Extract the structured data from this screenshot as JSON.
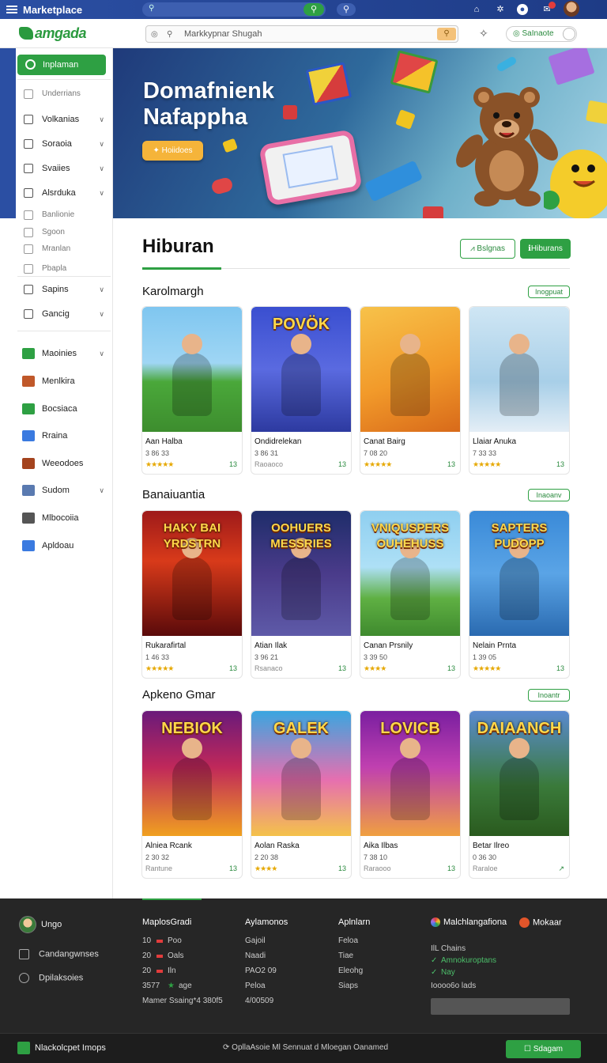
{
  "topbar": {
    "title": "Marketplace"
  },
  "header": {
    "logo": "amgada",
    "search_placeholder": "Markkypnar Shugah",
    "toggle_label": "SaInaote"
  },
  "sidebar": {
    "active": "Inplaman",
    "items": [
      {
        "label": "Underrians",
        "small": true,
        "chev": false
      },
      {
        "label": "Volkanias",
        "chev": true
      },
      {
        "label": "Soraoia",
        "chev": true
      },
      {
        "label": "Svaiies",
        "chev": true
      },
      {
        "label": "Alsrduka",
        "chev": true
      },
      {
        "label": "Banlionie",
        "small": true
      },
      {
        "label": "Sgoon",
        "small": true
      },
      {
        "label": "Mranlan",
        "small": true
      },
      {
        "label": "Pbapla",
        "small": true
      },
      {
        "label": "Sapins",
        "chev": true
      },
      {
        "label": "Gancig",
        "chev": true
      },
      {
        "label": "Maoinies",
        "chev": true
      },
      {
        "label": "Menlkira"
      },
      {
        "label": "Bocsiaca"
      },
      {
        "label": "Rraina"
      },
      {
        "label": "Weeodoes"
      },
      {
        "label": "Sudom",
        "chev": true
      },
      {
        "label": "Mlbocoiia"
      },
      {
        "label": "Apldoau"
      }
    ]
  },
  "hero": {
    "title_line1": "Domafnienk",
    "title_line2": "Nafappha",
    "button": "Hoiidoes"
  },
  "main": {
    "title": "Hiburan",
    "btn_outline": "Bslgnas",
    "btn_solid": "Hiburans"
  },
  "sections": [
    {
      "title": "Karolmargh",
      "pill": "Inogpuat",
      "cards": [
        {
          "name": "Aan Halba",
          "meta": "3 86 33",
          "rating": "★★★★★",
          "dl": "13",
          "art_title": ""
        },
        {
          "name": "Ondidrelekan",
          "meta": "3 86 31",
          "rating": "Raoaoco",
          "dl": "13",
          "art_title": "POVÖK"
        },
        {
          "name": "Canat Bairg",
          "meta": "7 08 20",
          "rating": "★★★★★",
          "dl": "13",
          "art_title": ""
        },
        {
          "name": "Llaiar Anuka",
          "meta": "7 33 33",
          "rating": "★★★★★",
          "dl": "13",
          "art_title": ""
        }
      ]
    },
    {
      "title": "Banaiuantia",
      "pill": "Inaoanv",
      "cards": [
        {
          "name": "Rukarafirtal",
          "meta": "1 46 33",
          "rating": "★★★★★",
          "dl": "13",
          "art_title": "HAKY BAI YRDSTRN"
        },
        {
          "name": "Atian Ilak",
          "meta": "3 96 21",
          "rating": "Rsanaco",
          "dl": "13",
          "art_title": "OOHUERS MESSRIES"
        },
        {
          "name": "Canan Prsnily",
          "meta": "3 39 50",
          "rating": "★★★★",
          "dl": "13",
          "art_title": "VNIQUSPERS OUHEHUSS"
        },
        {
          "name": "Nelain Prnta",
          "meta": "1 39 05",
          "rating": "★★★★★",
          "dl": "13",
          "art_title": "SAPTERS PUDOPP"
        }
      ]
    },
    {
      "title": "Apkeno Gmar",
      "pill": "Inoantr",
      "cards": [
        {
          "name": "Alniea Rcank",
          "meta": "2 30 32",
          "rating": "Rantune",
          "dl": "13",
          "art_title": "NEBIOK"
        },
        {
          "name": "Aolan Raska",
          "meta": "2 20 38",
          "rating": "★★★★",
          "dl": "13",
          "art_title": "GALEK"
        },
        {
          "name": "Aika Ilbas",
          "meta": "7 38 10",
          "rating": "Raraooo",
          "dl": "13",
          "art_title": "LOVICB"
        },
        {
          "name": "Betar Ilreo",
          "meta": "0 36 30",
          "rating": "Raraloe",
          "dl": "↗",
          "art_title": "DAIAANCH"
        }
      ]
    }
  ],
  "footer": {
    "user": "Ungo",
    "link1": "Candangwnses",
    "link2": "Dpilaksoies",
    "col1": {
      "head": "MaplosGradi",
      "rows": [
        {
          "n": "10",
          "t": "Poo"
        },
        {
          "n": "20",
          "t": "Oals"
        },
        {
          "n": "20",
          "t": "Iln"
        },
        {
          "n": "3577",
          "t": "age"
        }
      ],
      "foot": "Mamer Ssaing*4 380f5"
    },
    "col2": {
      "head": "Aylamonos",
      "items": [
        "Gajoil",
        "Naadi",
        "PAO2 09",
        "Peloa",
        "4/00509"
      ]
    },
    "col3": {
      "head": "Aplnlarn",
      "items": [
        "Feloa",
        "Tiae",
        "Eleohg",
        "Siaps"
      ]
    },
    "col4": {
      "head": "Malchlangafiona",
      "items": [
        "IlL Chains",
        "Amnokuroptans",
        "Nay",
        "Ioooo6o lads"
      ]
    },
    "col5": {
      "head": "Mokaar"
    }
  },
  "bottombar": {
    "left": "Nlackolcpet Imops",
    "center": "OpllaAsoie Ml Sennuat d Mloegan Oanamed",
    "button": "Sdagam"
  },
  "colors": {
    "brand_green": "#2ea043",
    "top_blue": "#2b4fa3",
    "footer_bg": "#262626"
  }
}
